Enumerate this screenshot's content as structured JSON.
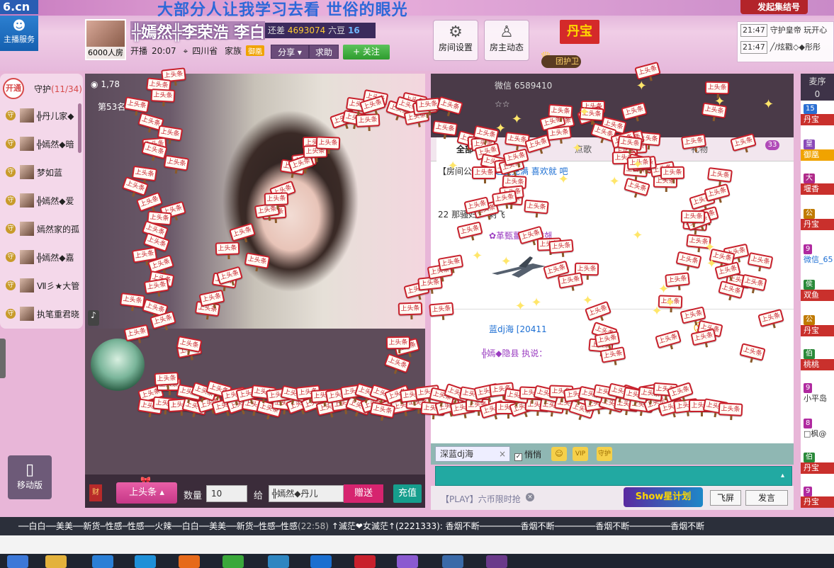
{
  "header": {
    "logo": "6.cn",
    "banner": "大部分人让我学习去看  世俗的眼光",
    "gather_button": "发起集结号",
    "anchor_service": "主播服务",
    "room_name": "╬嫣然╬李荣浩 李白",
    "room_count": "6000人房",
    "gap_label": "还差",
    "gap_value": "4693074",
    "gap_unit": "六豆",
    "gap_level": "16",
    "live_label": "开播",
    "live_time": "20:07",
    "location": "四川省",
    "family_label": "家族",
    "family_badge": "御凰",
    "share_label": "分享",
    "help_label": "求助",
    "follow_label": "+ 关注",
    "room_settings": "房间设置",
    "host_activity": "房主动态",
    "danbao": "丹宝",
    "tuanhu": "团护卫"
  },
  "messages": [
    {
      "time": "21:47",
      "text": "守护皇帝 玩开心"
    },
    {
      "time": "21:47",
      "text": "╱/炫戳◇◆彤彤"
    }
  ],
  "guard": {
    "open_label": "开通",
    "title": "守护",
    "count": "(11/34)",
    "items": [
      {
        "icon": "守",
        "name": "╬丹儿家◆"
      },
      {
        "icon": "守",
        "name": "╬嫣然◆暗"
      },
      {
        "icon": "守",
        "name": "梦如蓝"
      },
      {
        "icon": "守",
        "name": "╬嫣然◆爱"
      },
      {
        "icon": "守",
        "name": "嫣然家的孤"
      },
      {
        "icon": "守",
        "name": "╬嫣然◆嘉"
      },
      {
        "icon": "守",
        "name": "Ⅶ彡★大管"
      },
      {
        "icon": "守",
        "name": "执笔重君晓"
      }
    ]
  },
  "mobile_label": "移动版",
  "video": {
    "stat": "1,78",
    "rank": "第53名"
  },
  "gift": {
    "selected": "上头条",
    "qty_label": "数量",
    "qty_value": "10",
    "to_label": "给",
    "to_value": "╬嫣然◆丹儿",
    "send_label": "赠送",
    "recharge_label": "充值"
  },
  "chat_top": [
    {
      "text": "微信  6589410"
    },
    {
      "text": "☆☆"
    }
  ],
  "chat_tabs": [
    "全部",
    "点歌",
    "礼物"
  ],
  "chat_badge": "33",
  "chat": {
    "notice_label": "【房间公告】:",
    "notice_text": "这里充满 喜欢就 吧",
    "lines": [
      "22  那骚妇：  剩飞",
      "✿革甄薑✿사랑해",
      "蓝dj海 [20411",
      "╬嫣◆隐县    执说："
    ]
  },
  "chat_input": {
    "nick": "深蓝dj海",
    "whisper": "悄悄",
    "play_text": "【PLAY】六币限时抢",
    "show_plan": "Show星计划",
    "fly_label": "飞屏",
    "send_label": "发言"
  },
  "rank": {
    "title": "麦序",
    "count": "0",
    "items": [
      {
        "lvl": "15",
        "name": "丹宝"
      },
      {
        "lvl": "皇",
        "name": "御凰"
      },
      {
        "lvl": "大",
        "name": "堰香"
      },
      {
        "lvl": "公",
        "name": "丹宝"
      },
      {
        "lvl": "9",
        "name": "微信_65"
      },
      {
        "lvl": "侯",
        "name": "双鱼"
      },
      {
        "lvl": "公",
        "name": "丹宝"
      },
      {
        "lvl": "伯",
        "name": "桃桃"
      },
      {
        "lvl": "9",
        "name": "小平岛"
      },
      {
        "lvl": "8",
        "name": "□枫@"
      },
      {
        "lvl": "伯",
        "name": "丹宝"
      },
      {
        "lvl": "9",
        "name": "丹宝"
      }
    ]
  },
  "ticker": {
    "segments": "──白白──美美──新货─性感─性感──火辣──白白──美美──新货─性感─性感",
    "time": "(22:58)",
    "user": "↑滅茫❤女滅茫↑(2221333):",
    "tail": "香烟不断────────香烟不断────────香烟不断────────香烟不断"
  },
  "effect_sign_text": "上头条",
  "colors": {
    "accent_pink": "#d6246f",
    "follow_green": "#3aa83a",
    "chat_input_teal": "#22a9a2",
    "sign_red": "#c8202c"
  }
}
